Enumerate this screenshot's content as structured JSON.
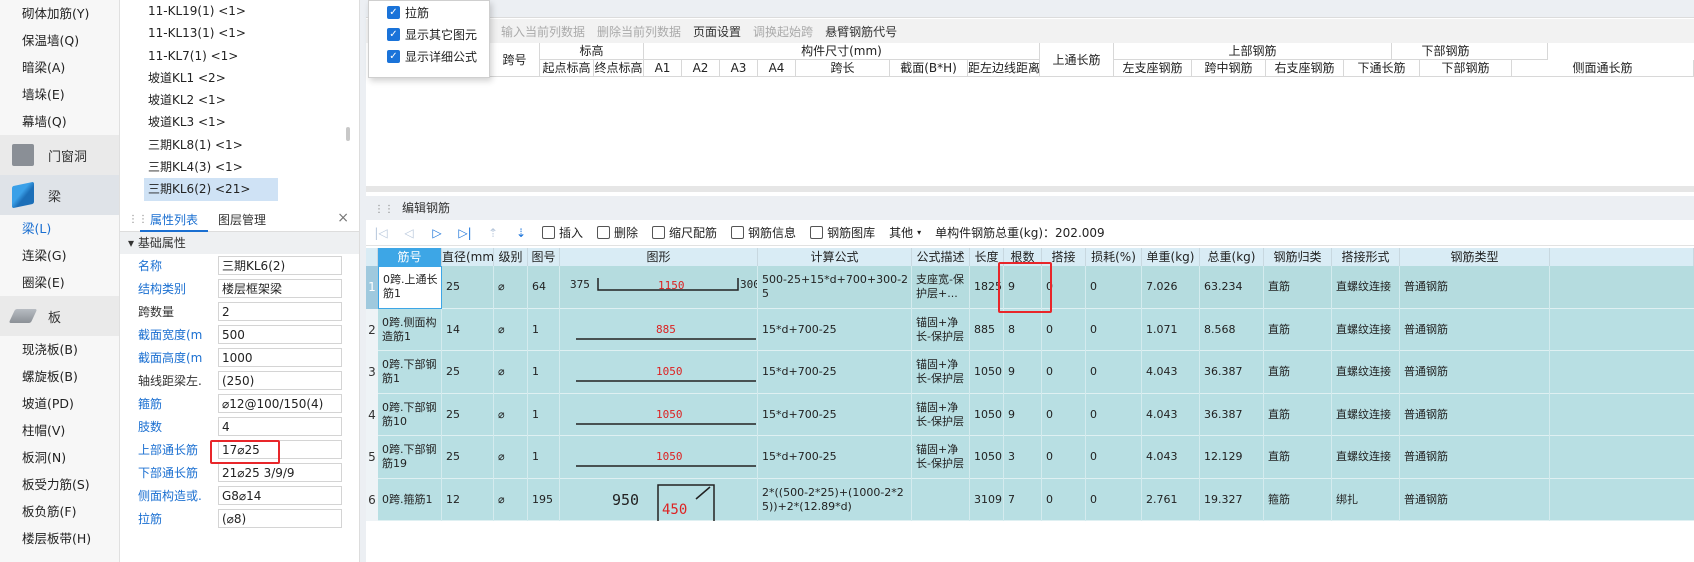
{
  "left_nav": {
    "items_top": [
      "砌体加筋(Y)",
      "保温墙(Q)",
      "暗梁(A)",
      "墙垛(E)",
      "幕墙(Q)"
    ],
    "cat_door": "门窗洞",
    "cat_beam": "梁",
    "beam_items": [
      "梁(L)",
      "连梁(G)",
      "圈梁(E)"
    ],
    "cat_slab": "板",
    "slab_items": [
      "现浇板(B)",
      "螺旋板(B)",
      "坡道(PD)",
      "柱帽(V)",
      "板洞(N)",
      "板受力筋(S)",
      "板负筋(F)",
      "楼层板带(H)"
    ]
  },
  "component_list": {
    "items": [
      "11-KL19(1) <1>",
      "11-KL13(1) <1>",
      "11-KL7(1) <1>",
      "坡道KL1 <2>",
      "坡道KL2 <1>",
      "坡道KL3 <1>",
      "三期KL8(1) <1>",
      "三期KL4(3) <1>",
      "三期KL6(2) <21>"
    ],
    "selected_index": 8
  },
  "properties": {
    "tab_active": "属性列表",
    "tab_other": "图层管理",
    "close": "×",
    "section": "基础属性",
    "rows": [
      {
        "name": "名称",
        "value": "三期KL6(2)",
        "blue": true
      },
      {
        "name": "结构类别",
        "value": "楼层框架梁",
        "blue": true
      },
      {
        "name": "跨数量",
        "value": "2",
        "blue": false
      },
      {
        "name": "截面宽度(mm)",
        "value": "500",
        "blue": true
      },
      {
        "name": "截面高度(mm)",
        "value": "1000",
        "blue": true
      },
      {
        "name": "轴线距梁左...",
        "value": "(250)",
        "blue": false
      },
      {
        "name": "箍筋",
        "value": "⌀12@100/150(4)",
        "blue": true
      },
      {
        "name": "肢数",
        "value": "4",
        "blue": true
      },
      {
        "name": "上部通长筋",
        "value": "17⌀25",
        "blue": true
      },
      {
        "name": "下部通长筋",
        "value": "21⌀25 3/9/9",
        "blue": true
      },
      {
        "name": "侧面构造或...",
        "value": "G8⌀14",
        "blue": true
      },
      {
        "name": "拉筋",
        "value": "(⌀8)",
        "blue": true
      }
    ]
  },
  "popup": {
    "options": [
      "拉筋",
      "显示其它图元",
      "显示详细公式"
    ]
  },
  "upper_toolbar": {
    "items": [
      {
        "label": "输入当前列数据",
        "enabled": false
      },
      {
        "label": "删除当前列数据",
        "enabled": false
      },
      {
        "label": "页面设置",
        "enabled": true
      },
      {
        "label": "调换起始跨",
        "enabled": false
      },
      {
        "label": "悬臂钢筋代号",
        "enabled": true
      }
    ]
  },
  "upper_headers": {
    "span_no": "跨号",
    "elevation": "标高",
    "elev_start": "起点标高",
    "elev_end": "终点标高",
    "dims": "构件尺寸(mm)",
    "a1": "A1",
    "a2": "A2",
    "a3": "A3",
    "a4": "A4",
    "span_len": "跨长",
    "section": "截面(B*H)",
    "dist_left": "距左边线距离",
    "top_through": "上通长筋",
    "top_rebar": "上部钢筋",
    "left_support": "左支座钢筋",
    "mid_span": "跨中钢筋",
    "right_support": "右支座钢筋",
    "bottom_rebar": "下部钢筋",
    "bottom_through": "下通长筋",
    "bottom_rebar2": "下部钢筋",
    "side_through": "侧面通长筋"
  },
  "lower": {
    "title": "编辑钢筋",
    "toolbar": {
      "insert": "插入",
      "delete": "删除",
      "scale": "缩尺配筋",
      "info": "钢筋信息",
      "library": "钢筋图库",
      "other": "其他",
      "total_label": "单构件钢筋总重(kg)：202.009"
    },
    "headers": [
      "筋号",
      "直径(mm)",
      "级别",
      "图号",
      "图形",
      "计算公式",
      "公式描述",
      "长度",
      "根数",
      "搭接",
      "损耗(%)",
      "单重(kg)",
      "总重(kg)",
      "钢筋归类",
      "搭接形式",
      "钢筋类型"
    ],
    "rows": [
      {
        "no": "1",
        "name": "0跨.上通长筋1",
        "dia": "25",
        "grade": "⌀",
        "fig": "64",
        "shape": {
          "left": "375",
          "mid": "1150",
          "right": "300"
        },
        "formula": "500-25+15*d+700+300-25",
        "desc": "支座宽-保护层+...",
        "len": "1825",
        "count": "9",
        "lap": "0",
        "loss": "0",
        "unit": "7.026",
        "total": "63.234",
        "cat": "直筋",
        "lap_type": "直螺纹连接",
        "type": "普通钢筋"
      },
      {
        "no": "2",
        "name": "0跨.侧面构造筋1",
        "dia": "14",
        "grade": "⌀",
        "fig": "1",
        "shape": {
          "mid": "885"
        },
        "formula": "15*d+700-25",
        "desc": "锚固+净长-保护层",
        "len": "885",
        "count": "8",
        "lap": "0",
        "loss": "0",
        "unit": "1.071",
        "total": "8.568",
        "cat": "直筋",
        "lap_type": "直螺纹连接",
        "type": "普通钢筋"
      },
      {
        "no": "3",
        "name": "0跨.下部钢筋1",
        "dia": "25",
        "grade": "⌀",
        "fig": "1",
        "shape": {
          "mid": "1050"
        },
        "formula": "15*d+700-25",
        "desc": "锚固+净长-保护层",
        "len": "1050",
        "count": "9",
        "lap": "0",
        "loss": "0",
        "unit": "4.043",
        "total": "36.387",
        "cat": "直筋",
        "lap_type": "直螺纹连接",
        "type": "普通钢筋"
      },
      {
        "no": "4",
        "name": "0跨.下部钢筋10",
        "dia": "25",
        "grade": "⌀",
        "fig": "1",
        "shape": {
          "mid": "1050"
        },
        "formula": "15*d+700-25",
        "desc": "锚固+净长-保护层",
        "len": "1050",
        "count": "9",
        "lap": "0",
        "loss": "0",
        "unit": "4.043",
        "total": "36.387",
        "cat": "直筋",
        "lap_type": "直螺纹连接",
        "type": "普通钢筋"
      },
      {
        "no": "5",
        "name": "0跨.下部钢筋19",
        "dia": "25",
        "grade": "⌀",
        "fig": "1",
        "shape": {
          "mid": "1050"
        },
        "formula": "15*d+700-25",
        "desc": "锚固+净长-保护层",
        "len": "1050",
        "count": "3",
        "lap": "0",
        "loss": "0",
        "unit": "4.043",
        "total": "12.129",
        "cat": "直筋",
        "lap_type": "直螺纹连接",
        "type": "普通钢筋"
      },
      {
        "no": "6",
        "name": "0跨.箍筋1",
        "dia": "12",
        "grade": "⌀",
        "fig": "195",
        "shape": {
          "left": "950",
          "mid": "450"
        },
        "formula": "2*((500-2*25)+(1000-2*25))+2*(12.89*d)",
        "desc": "",
        "len": "3109",
        "count": "7",
        "lap": "0",
        "loss": "0",
        "unit": "2.761",
        "total": "19.327",
        "cat": "箍筋",
        "lap_type": "绑扎",
        "type": "普通钢筋"
      }
    ]
  },
  "colors": {
    "accent": "#1a73d9",
    "highlight": "#e8262a",
    "row_bg": "#b8dfe3",
    "header_bg": "#d9ecf5"
  }
}
